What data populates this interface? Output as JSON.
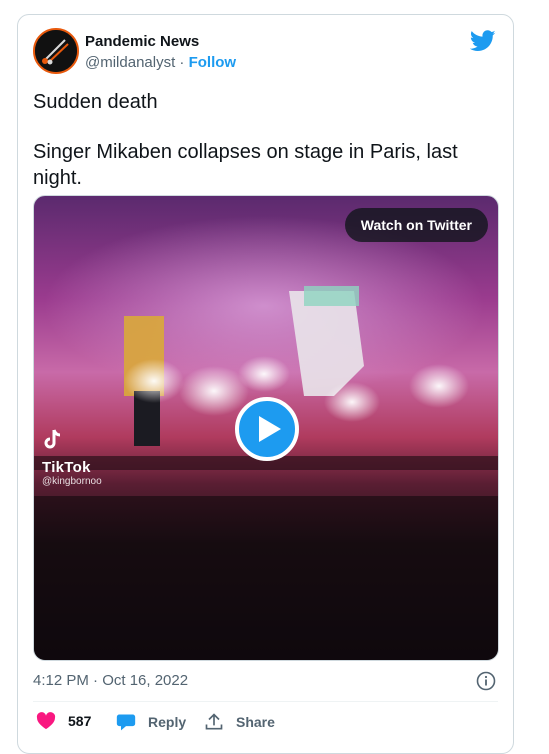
{
  "tweet": {
    "author_name": "Pandemic News",
    "handle": "@mildanalyst",
    "separator": " · ",
    "follow_label": "Follow",
    "text_line1": "Sudden death",
    "text_line2": "Singer Mikaben collapses on stage in Paris, last night.",
    "timestamp": "4:12 PM · Oct 16, 2022"
  },
  "media": {
    "watch_label": "Watch on Twitter",
    "watermark_brand": "TikTok",
    "watermark_handle": "@kingbornoo",
    "player_state": "paused"
  },
  "actions": {
    "like_count": "587",
    "reply_label": "Reply",
    "share_label": "Share"
  },
  "icons": {
    "brand": "twitter-bird-icon",
    "like": "heart-icon",
    "reply": "speech-bubble-icon",
    "share": "share-upload-icon",
    "info": "info-icon",
    "play": "play-icon"
  },
  "colors": {
    "accent": "#1d9bf0",
    "like": "#f91880",
    "text_primary": "#0f1419",
    "text_secondary": "#536471",
    "avatar_ring": "#e8590c"
  }
}
